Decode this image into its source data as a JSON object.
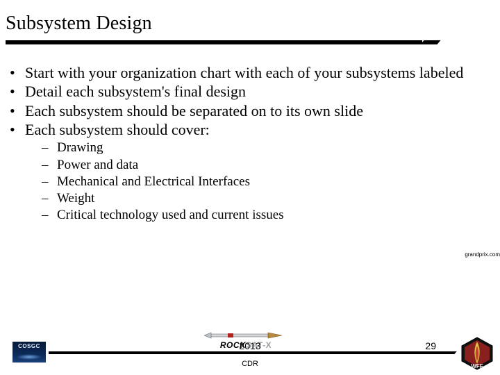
{
  "title": "Subsystem Design",
  "bullets": [
    "Start with your organization chart with each of your subsystems labeled",
    "Detail each subsystem's final design",
    "Each subsystem should be separated on to its own slide",
    "Each subsystem should cover:"
  ],
  "subbullets": [
    "Drawing",
    "Power and data",
    "Mechanical and Electrical Interfaces",
    "Weight",
    "Critical technology used and current issues"
  ],
  "citation": "grandprix.com",
  "footer": {
    "left_logo_text": "COSGC",
    "center_brand_a": "ROCK",
    "center_brand_b": "SAT-X",
    "year": "2013",
    "label": "CDR",
    "page": "29",
    "right_logo_text": "WFF"
  }
}
